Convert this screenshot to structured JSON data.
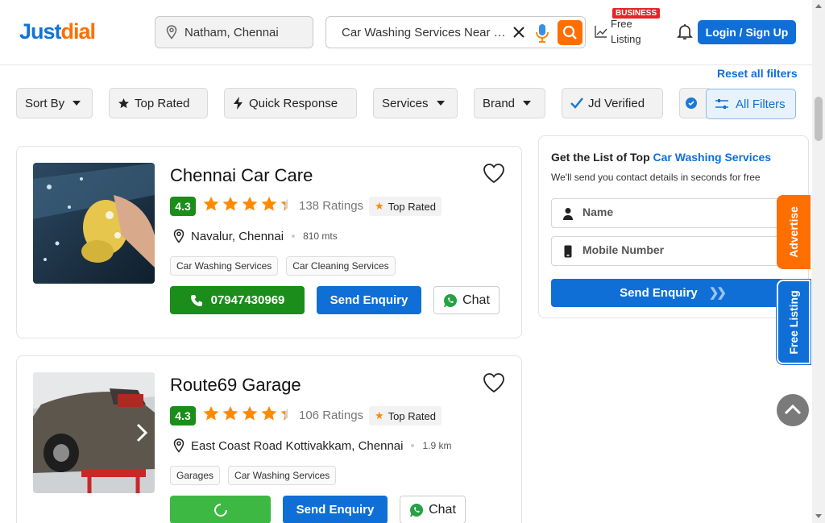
{
  "header": {
    "logo_part1": "Just",
    "logo_part2": "dial",
    "location": "Natham, Chennai",
    "search_text": "Car Washing Services Near Me",
    "business_badge": "BUSINESS",
    "free_listing_line1": "Free",
    "free_listing_line2": "Listing",
    "login_label": "Login / Sign Up"
  },
  "filters": {
    "reset_label": "Reset all filters",
    "chips": [
      "Sort By",
      "Top Rated",
      "Quick Response",
      "Services",
      "Brand",
      "Jd Verified"
    ],
    "all_filters_label": "All Filters"
  },
  "listings": [
    {
      "name": "Chennai Car Care",
      "rating": "4.3",
      "stars": 4.3,
      "ratings_count": "138 Ratings",
      "badge": "Top Rated",
      "address": "Navalur, Chennai",
      "distance": "810 mts",
      "tags": [
        "Car Washing Services",
        "Car Cleaning Services"
      ],
      "phone": "07947430969",
      "enquiry_label": "Send Enquiry",
      "chat_label": "Chat"
    },
    {
      "name": "Route69 Garage",
      "rating": "4.3",
      "stars": 4.3,
      "ratings_count": "106 Ratings",
      "badge": "Top Rated",
      "address": "East Coast Road Kottivakkam, Chennai",
      "distance": "1.9 km",
      "tags": [
        "Garages",
        "Car Washing Services"
      ],
      "enquiry_label": "Send Enquiry",
      "chat_label": "Chat"
    }
  ],
  "panel": {
    "heading_prefix": "Get the List of Top",
    "heading_highlight": "Car Washing Services",
    "subtext": "We'll send you contact details in seconds for free",
    "name_placeholder": "Name",
    "mobile_placeholder": "Mobile Number",
    "send_label": "Send Enquiry"
  },
  "side_tabs": {
    "advertise": "Advertise",
    "free_listing": "Free Listing"
  },
  "colors": {
    "brand_blue": "#0f6fd6",
    "brand_orange": "#ff6e00",
    "rating_green": "#1a8d1a",
    "star_orange": "#ff8a00"
  }
}
